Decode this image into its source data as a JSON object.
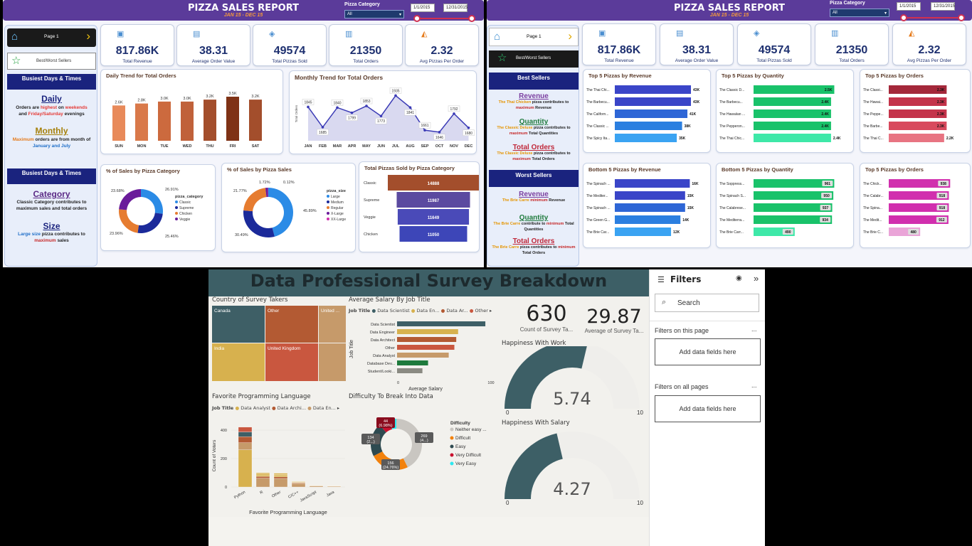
{
  "report": {
    "title": "PIZZA SALES REPORT",
    "subtitle": "JAN 15 - DEC 15",
    "category_label": "Pizza Category",
    "category_value": "All",
    "date_from": "1/1/2015",
    "date_to": "12/31/2015"
  },
  "kpis": [
    {
      "value": "817.86K",
      "label": "Total Revenue",
      "icon": "money-icon"
    },
    {
      "value": "38.31",
      "label": "Average Order Value",
      "icon": "receipt-icon"
    },
    {
      "value": "49574",
      "label": "Total Pizzas Sold",
      "icon": "pizzas-icon"
    },
    {
      "value": "21350",
      "label": "Total Orders",
      "icon": "orders-icon"
    },
    {
      "value": "2.32",
      "label": "Avg Pizzas Per Order",
      "icon": "pizza-slice-icon"
    }
  ],
  "page1": {
    "nav_label": "Page 1",
    "best_worst_label": "Best/Worst Sellers",
    "busiest_header_1": "Busiest Days & Times",
    "daily_title": "Daily",
    "daily_pre": "Orders are ",
    "daily_hi1": "highest",
    "daily_mid": " on ",
    "daily_hi2": "weekends",
    "daily_and": " and ",
    "daily_hi3": "Friday/Saturday",
    "daily_post": " evenings",
    "monthly_title": "Monthly",
    "monthly_hi": "Maximum",
    "monthly_mid": " orders are from month of ",
    "monthly_months": "January and July",
    "busiest_header_2": "Busiest Days & Times",
    "category_title": "Category",
    "category_text": "Classic Category contributes to maximum sales and total orders",
    "size_title": "Size",
    "size_hi": "Large size",
    "size_mid": " pizza contributes to ",
    "size_hi2": "maximum",
    "size_post": " sales",
    "daily_chart_title": "Daily Trend for Total Orders",
    "monthly_chart_title": "Monthly Trend for Total Orders",
    "cat_chart_title": "% of Sales by Pizza Category",
    "size_chart_title": "% of Sales by Pizza Sales",
    "funnel_title": "Total Pizzas Sold by Pizza Category",
    "cat_legend_title": "pizza_category",
    "size_legend_title": "pizza_size"
  },
  "page2": {
    "nav_label": "Page 1",
    "best_worst_label": "Best/Worst Sellers",
    "best_header": "Best Sellers",
    "worst_header": "Worst Sellers",
    "best_items": [
      {
        "title": "Revenue",
        "hi": "The Thai Chicken",
        "mid": " pizza contributes to ",
        "hi2": "maximum",
        "post": " Revenue"
      },
      {
        "title": "Quantity",
        "hi": "The Classic Deluxe",
        "mid": " pizza contributes to ",
        "hi2": "maximum",
        "post": " Total Quantities"
      },
      {
        "title": "Total Orders",
        "hi": "The Classic Deluxe",
        "mid": " pizza contributes to ",
        "hi2": "maximum",
        "post": " Total Orders"
      }
    ],
    "worst_items": [
      {
        "title": "Revenue",
        "hi": "The Brie Carre",
        "mid": " ",
        "hi2": "minimum",
        "post": " Revenue"
      },
      {
        "title": "Quantity",
        "hi": "The Brie Carre",
        "mid": " contribute to ",
        "hi2": "minimum",
        "post": " Total Quantities"
      },
      {
        "title": "Total Orders",
        "hi": "The Brie Carre",
        "mid": " pizza contributes to ",
        "hi2": "minimum",
        "post": " Total Orders"
      }
    ]
  },
  "survey": {
    "title": "Data Professional Survey Breakdown",
    "country_title": "Country of Survey Takers",
    "salary_title": "Average Salary By Job Title",
    "salary_legend_label": "Job Title",
    "salary_legend": [
      "Data Scientist",
      "Data En...",
      "Data Ar...",
      "Other"
    ],
    "salary_xlabel": "Average Salary",
    "salary_ylabel": "Job Title",
    "lang_title": "Favorite Programming Language",
    "lang_legend_label": "Job Title",
    "lang_legend": [
      "Data Analyst",
      "Data Archi...",
      "Data En..."
    ],
    "lang_xlabel": "Favorite Programming Language",
    "lang_ylabel": "Count of Voters",
    "diff_title": "Difficulty To Break Into Data",
    "diff_legend_title": "Difficulty",
    "count_value": "630",
    "count_label": "Count of Survey Ta...",
    "age_value": "29.87",
    "age_label": "Average of Survey Ta...",
    "hw_title": "Happiness With Work",
    "hw_value": "5.74",
    "hs_title": "Happiness With Salary",
    "hs_value": "4.27",
    "gauge_min": "0",
    "gauge_max": "10"
  },
  "filters": {
    "title": "Filters",
    "search_placeholder": "Search",
    "on_page": "Filters on this page",
    "on_all": "Filters on all pages",
    "add_label": "Add data fields here",
    "more": "..."
  },
  "colors": {
    "header_purple": "#5b3b9a",
    "navy": "#1a237e",
    "kpi_blue": "#1e3070",
    "survey_teal": "#3d5f66"
  },
  "chart_data": [
    {
      "type": "bar",
      "title": "Daily Trend for Total Orders",
      "categories": [
        "SUN",
        "MON",
        "TUE",
        "WED",
        "THU",
        "FRI",
        "SAT"
      ],
      "values": [
        2.6,
        2.8,
        3.0,
        3.0,
        3.2,
        3.5,
        3.2
      ],
      "labels": [
        "2.6K",
        "2.8K",
        "3.0K",
        "3.0K",
        "3.2K",
        "3.5K",
        "3.2K"
      ]
    },
    {
      "type": "area",
      "title": "Monthly Trend for Total Orders",
      "categories": [
        "JAN",
        "FEB",
        "MAR",
        "APR",
        "MAY",
        "JUN",
        "JUL",
        "AUG",
        "SEP",
        "OCT",
        "NOV",
        "DEC"
      ],
      "values": [
        1845,
        1685,
        1840,
        1799,
        1853,
        1773,
        1935,
        1841,
        1661,
        1646,
        1792,
        1680
      ],
      "ylabel": "Total Orders"
    },
    {
      "type": "pie",
      "title": "% of Sales by Pizza Category",
      "labels": [
        "Classic",
        "Supreme",
        "Chicken",
        "Veggie"
      ],
      "values": [
        26.91,
        25.46,
        23.96,
        23.68
      ],
      "value_labels": [
        "26.91%",
        "25.46%",
        "23.96%",
        "23.68%"
      ]
    },
    {
      "type": "pie",
      "title": "% of Sales by Pizza Sales",
      "labels": [
        "Large",
        "Medium",
        "Regular",
        "X-Large",
        "XX-Large"
      ],
      "values": [
        45.89,
        30.49,
        21.77,
        1.72,
        0.12
      ],
      "value_labels": [
        "45.89%",
        "30.49%",
        "21.77%",
        "1.72%",
        "0.12%"
      ]
    },
    {
      "type": "bar",
      "title": "Total Pizzas Sold by Pizza Category",
      "categories": [
        "Classic",
        "Supreme",
        "Veggie",
        "Chicken"
      ],
      "values": [
        14888,
        11987,
        11649,
        11050
      ]
    },
    {
      "type": "bar",
      "title": "Top 5 Pizzas by Revenue",
      "categories": [
        "The Thai Chi...",
        "The Barbecu...",
        "The Californ...",
        "The Classic ...",
        "The Spicy Ita..."
      ],
      "values": [
        43,
        43,
        41,
        38,
        35
      ],
      "labels": [
        "43K",
        "43K",
        "41K",
        "38K",
        "35K"
      ]
    },
    {
      "type": "bar",
      "title": "Top 5 Pizzas by Quantity",
      "categories": [
        "The Classic D...",
        "The Barbecu...",
        "The Hawaiian ...",
        "The Pepperon...",
        "The Thai Chic..."
      ],
      "values": [
        2.5,
        2.4,
        2.4,
        2.4,
        2.4
      ],
      "labels": [
        "2.5K",
        "2.4K",
        "2.4K",
        "2.4K",
        "2.4K"
      ]
    },
    {
      "type": "bar",
      "title": "Top 5 Pizzas by Orders",
      "categories": [
        "The Classi...",
        "The Hawai...",
        "The Peppe...",
        "The Barbe...",
        "The Thai C..."
      ],
      "values": [
        2.3,
        2.3,
        2.3,
        2.3,
        2.2
      ],
      "labels": [
        "2.3K",
        "2.3K",
        "2.3K",
        "2.3K",
        "2.2K"
      ]
    },
    {
      "type": "bar",
      "title": "Bottom 5 Pizzas by Revenue",
      "categories": [
        "The Spinach ...",
        "The Mediter...",
        "The Spinach ...",
        "The Green G...",
        "The Brie Car..."
      ],
      "values": [
        16,
        15,
        15,
        14,
        12
      ],
      "labels": [
        "16K",
        "15K",
        "15K",
        "14K",
        "12K"
      ]
    },
    {
      "type": "bar",
      "title": "Bottom 5 Pizzas by Quantity",
      "categories": [
        "The Soppress...",
        "The Spinach S...",
        "The Calabrese...",
        "The Mediterra...",
        "The Brie Carr..."
      ],
      "values": [
        961,
        950,
        937,
        934,
        490
      ],
      "labels": [
        "961",
        "950",
        "937",
        "934",
        "490"
      ]
    },
    {
      "type": "bar",
      "title": "Top 5 Pizzas by Orders",
      "categories": [
        "The Chick...",
        "The Calabr...",
        "The Spina...",
        "The Medit...",
        "The Brie C..."
      ],
      "values": [
        938,
        918,
        918,
        912,
        480
      ],
      "labels": [
        "938",
        "918",
        "918",
        "912",
        "480"
      ]
    },
    {
      "type": "heatmap",
      "title": "Country of Survey Takers",
      "categories": [
        "Canada",
        "Other",
        "United ...",
        "India",
        "United Kingdom"
      ]
    },
    {
      "type": "bar",
      "title": "Average Salary By Job Title",
      "categories": [
        "Data Scientist",
        "Data Engineer",
        "Data Architect",
        "Other",
        "Data Analyst",
        "Database Dev...",
        "Student/Looki..."
      ],
      "values": [
        94,
        65,
        63,
        61,
        55,
        33,
        27
      ],
      "xlim": [
        0,
        100
      ]
    },
    {
      "type": "bar",
      "title": "Favorite Programming Language",
      "categories": [
        "Python",
        "R",
        "Other",
        "C/C++",
        "JavaScript",
        "Java"
      ],
      "values": [
        421,
        100,
        97,
        38,
        12,
        8
      ],
      "ylim": [
        0,
        400
      ],
      "yticks": [
        0,
        200,
        400
      ]
    },
    {
      "type": "pie",
      "title": "Difficulty To Break Into Data",
      "labels": [
        "Neither easy ...",
        "Difficult",
        "Easy",
        "Very Difficult",
        "Very Easy"
      ],
      "values": [
        269,
        156,
        134,
        44,
        27
      ],
      "value_labels": [
        "269\n(4...)",
        "156\n(24.76%)",
        "134\n(2...)",
        "44\n(6.98%)",
        ""
      ]
    }
  ]
}
